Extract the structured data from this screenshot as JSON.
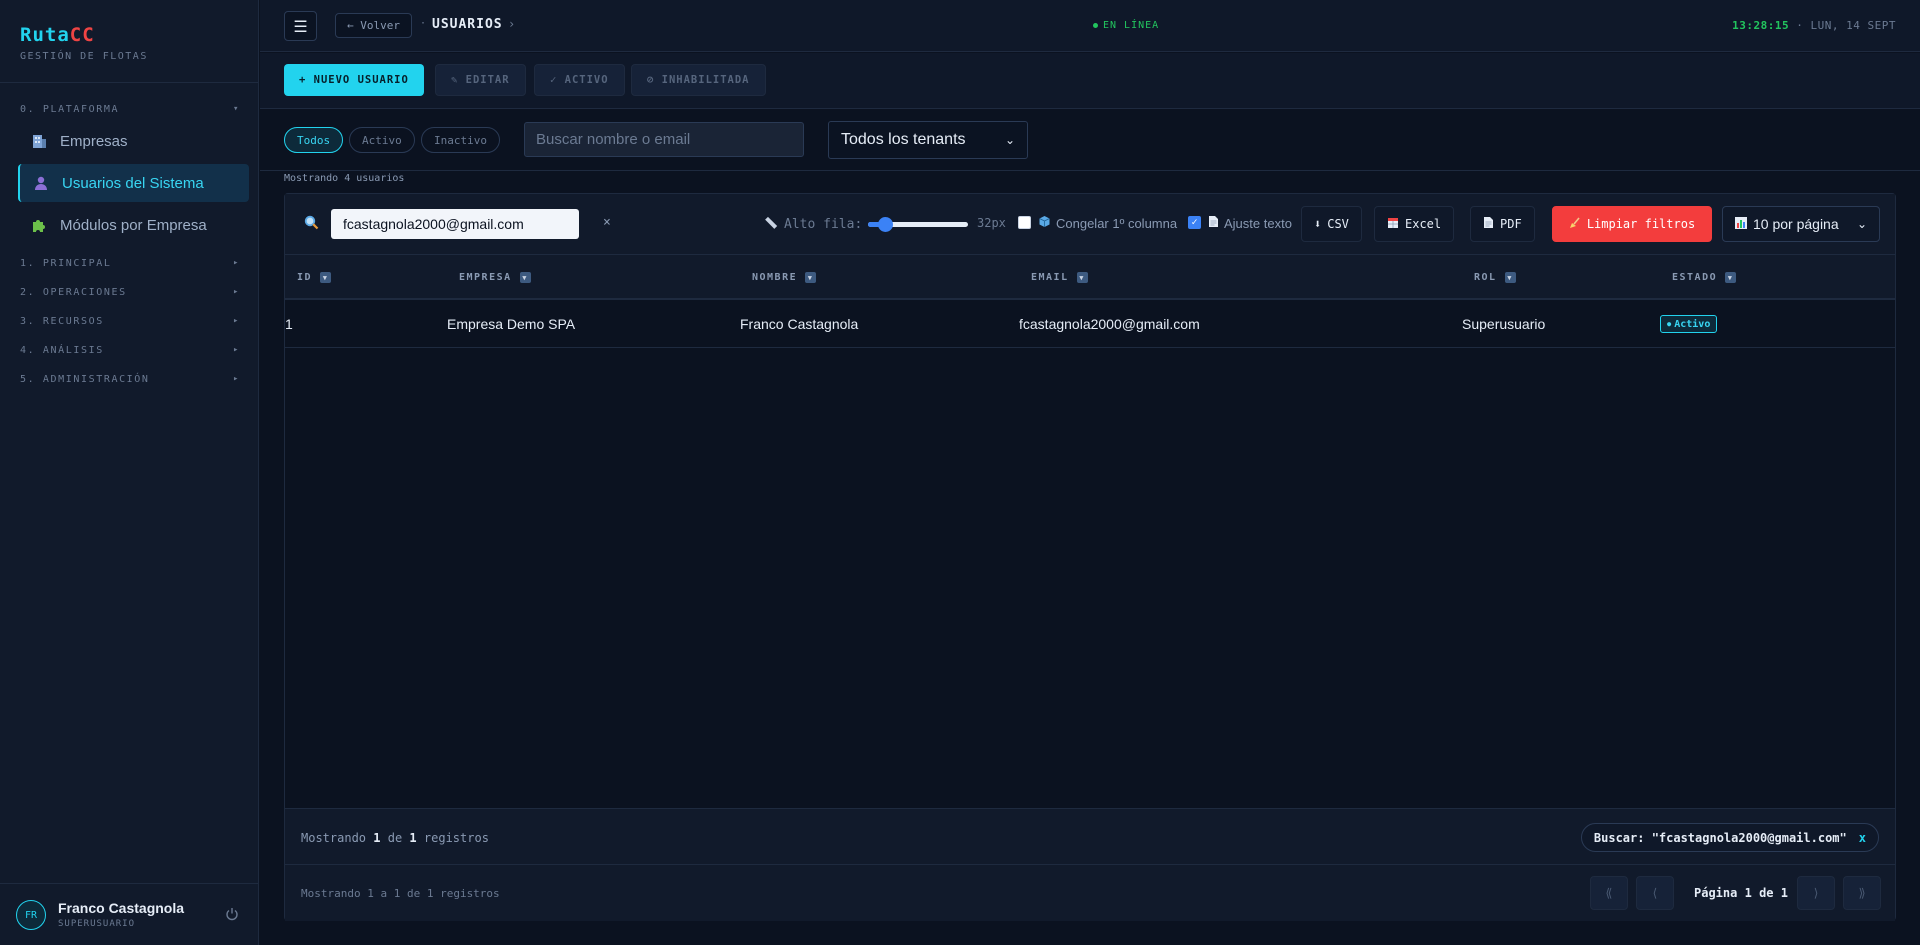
{
  "brand": {
    "part1": "Ruta",
    "part2": "CC",
    "subtitle": "GESTIÓN DE FLOTAS"
  },
  "sidebar": {
    "section0": "0. PLATAFORMA",
    "items": [
      {
        "label": "Empresas",
        "icon": "building-icon"
      },
      {
        "label": "Usuarios del Sistema",
        "icon": "user-icon"
      },
      {
        "label": "Módulos por Empresa",
        "icon": "puzzle-icon"
      }
    ],
    "sections": [
      "1. PRINCIPAL",
      "2. OPERACIONES",
      "3. RECURSOS",
      "4. ANÁLISIS",
      "5. ADMINISTRACIÓN"
    ],
    "user": {
      "initials": "FR",
      "name": "Franco Castagnola",
      "role": "SUPERUSUARIO"
    }
  },
  "topbar": {
    "back_label": "← Volver",
    "breadcrumb": "USUARIOS",
    "status": "EN LÍNEA",
    "time": "13:28:15",
    "date": "· LUN, 14 SEPT"
  },
  "actions": {
    "new_user": "+ NUEVO USUARIO",
    "edit": "✎ EDITAR",
    "active": "✓ ACTIVO",
    "disabled": "⊘ INHABILITADA"
  },
  "filters": {
    "pills": [
      "Todos",
      "Activo",
      "Inactivo"
    ],
    "search_placeholder": "Buscar nombre o email",
    "tenant_selected": "Todos los tenants",
    "count_label": "Mostrando 4 usuarios"
  },
  "table_toolbar": {
    "search_value": "fcastagnola2000@gmail.com",
    "clear": "×",
    "row_height_label": "Alto fila:",
    "row_height_value": "32px",
    "row_height_level": 0.12,
    "freeze_label": "Congelar 1º columna",
    "freeze_checked": false,
    "wrap_label": "Ajuste texto",
    "wrap_checked": true,
    "csv": "CSV",
    "excel": "Excel",
    "pdf": "PDF",
    "clear_filters": "Limpiar filtros",
    "per_page": "10 por página"
  },
  "table": {
    "columns": [
      "ID",
      "EMPRESA",
      "NOMBRE",
      "EMAIL",
      "ROL",
      "ESTADO"
    ],
    "rows": [
      {
        "id": "1",
        "empresa": "Empresa Demo SPA",
        "nombre": "Franco Castagnola",
        "email": "fcastagnola2000@gmail.com",
        "rol": "Superusuario",
        "estado": "Activo"
      }
    ]
  },
  "footer": {
    "summary_prefix": "Mostrando",
    "summary_from": "1",
    "summary_mid": "de",
    "summary_total": "1",
    "summary_suffix": "registros",
    "filter_chip": "Buscar: \"fcastagnola2000@gmail.com\"",
    "filter_chip_close": "x",
    "range_text": "Mostrando 1 a 1 de 1 registros",
    "page_prefix": "Página",
    "page_current": "1",
    "page_mid": "de",
    "page_total": "1"
  }
}
